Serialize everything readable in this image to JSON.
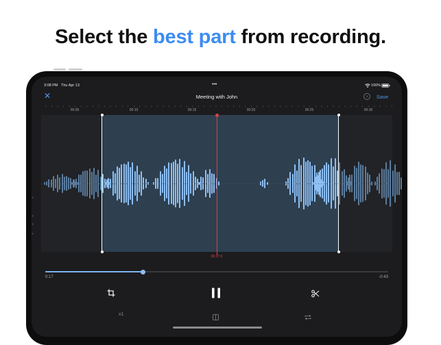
{
  "headline": {
    "before": "Select the ",
    "accent": "best part",
    "after": " from recording."
  },
  "status_bar": {
    "time": "3:08 PM",
    "date": "Thu Apr 13",
    "dots": "•••",
    "battery": "100%"
  },
  "nav": {
    "title": "Meeting with John",
    "save_label": "Save"
  },
  "timeline": {
    "ticks": [
      "00:05",
      "00:10",
      "00:15",
      "00:20",
      "00:25",
      "00:30"
    ]
  },
  "playhead": {
    "label": "00:17.0"
  },
  "progress": {
    "elapsed": "0:17",
    "remaining": "-0:43",
    "fraction": 0.285
  },
  "playback": {
    "speed": "x1"
  },
  "colors": {
    "accent": "#3d8cf2",
    "playhead": "#d64545",
    "selected_bars": "#8ec0f5",
    "unselected_bars": "#5b7d9e"
  },
  "icons": {
    "close": "close-icon",
    "restore": "restore-icon",
    "crop": "crop-icon",
    "pause": "pause-icon",
    "scissors": "scissors-icon",
    "split": "split-view-icon",
    "loop": "loop-icon"
  }
}
